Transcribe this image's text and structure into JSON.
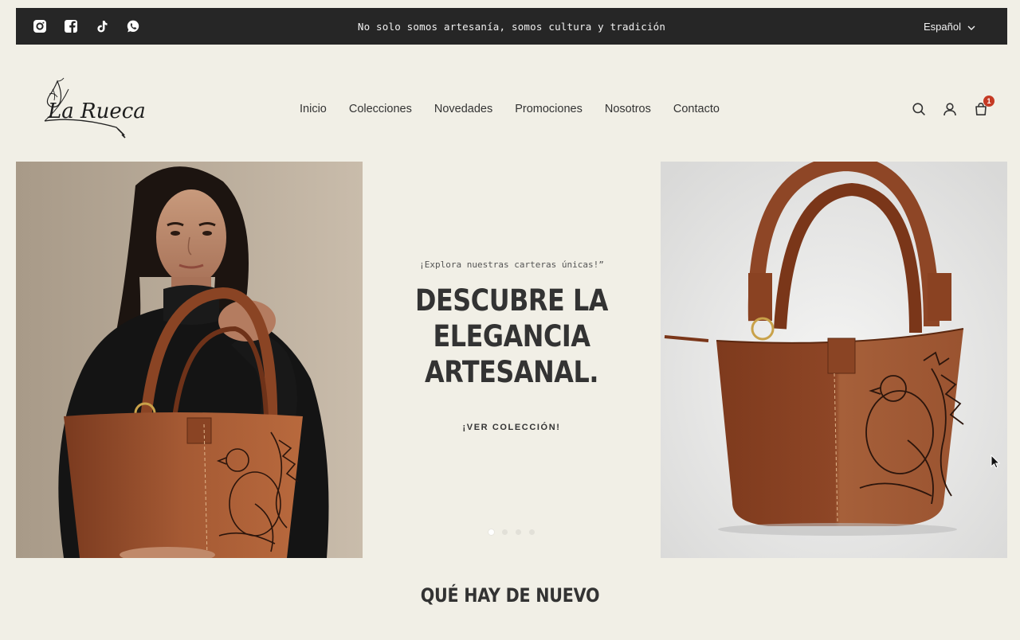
{
  "announcement": {
    "text": "No solo somos artesanía, somos cultura y tradición",
    "language": "Español",
    "social_icons": [
      "instagram-icon",
      "facebook-icon",
      "tiktok-icon",
      "whatsapp-icon"
    ]
  },
  "brand": {
    "logo_text": "La Rueca"
  },
  "nav": {
    "items": [
      "Inicio",
      "Colecciones",
      "Novedades",
      "Promociones",
      "Nosotros",
      "Contacto"
    ]
  },
  "header": {
    "cart_count": "1",
    "icons": [
      "search-icon",
      "account-icon",
      "cart-icon"
    ]
  },
  "hero": {
    "eyebrow": "¡Explora nuestras carteras únicas!”",
    "headline": "DESCUBRE LA ELEGANCIA ARTESANAL.",
    "cta": "¡VER COLECCIÓN!",
    "slides_total": 4,
    "active_slide": 1
  },
  "section": {
    "title": "QUÉ HAY DE NUEVO"
  },
  "colors": {
    "background": "#f1efe6",
    "topbar": "#262626",
    "text": "#333333",
    "badge": "#c53a24",
    "leather": "#8a4426"
  }
}
